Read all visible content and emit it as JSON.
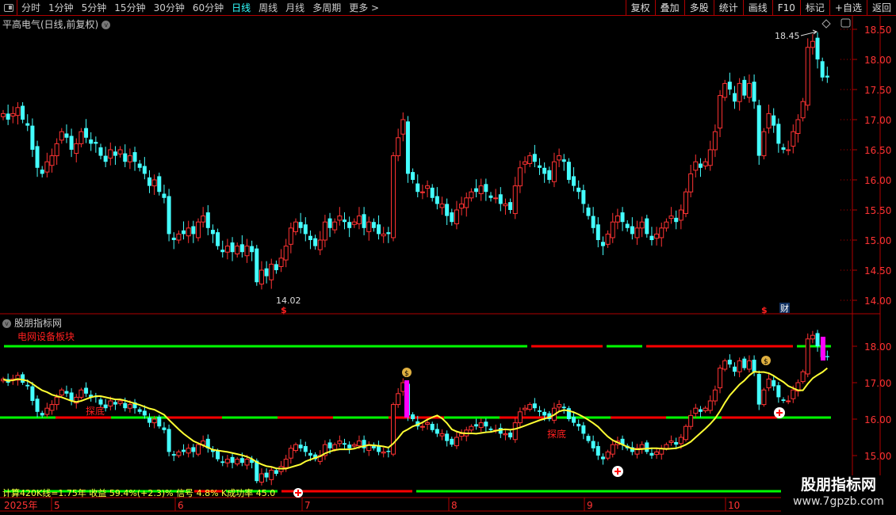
{
  "toolbar": {
    "periods": [
      "分时",
      "1分钟",
      "5分钟",
      "15分钟",
      "30分钟",
      "60分钟",
      "日线",
      "周线",
      "月线",
      "多周期",
      "更多 >"
    ],
    "active": "日线",
    "buttons": [
      "复权",
      "叠加",
      "多股",
      "统计",
      "画线",
      "F10",
      "标记",
      "+自选",
      "返回"
    ]
  },
  "stock": {
    "title": "平高电气(日线,前复权)"
  },
  "price_axis": [
    "18.50",
    "18.00",
    "17.50",
    "17.00",
    "16.50",
    "16.00",
    "15.50",
    "15.00",
    "14.50",
    "14.00"
  ],
  "indicator_axis": [
    "18.00",
    "17.00",
    "16.00",
    "15.00"
  ],
  "annotations": {
    "high": "18.45",
    "low": "14.02",
    "dollar": "$",
    "cai": "财",
    "tandi": "探底"
  },
  "indicator": {
    "title": "股朋指标网",
    "sector": "电网设备板块",
    "stats": "计算420K线=1.75年 收益 59.4%(+2.3)% 信号 4.8% K成功率 45.0"
  },
  "date_axis": [
    {
      "label": "2025年"
    },
    {
      "label": "5"
    },
    {
      "label": "6"
    },
    {
      "label": "7"
    },
    {
      "label": "8"
    },
    {
      "label": "9"
    },
    {
      "label": "10"
    }
  ],
  "watermark": {
    "name": "股朋指标网",
    "url": "www.7gpzb.com"
  },
  "colors": {
    "up": "#ff3333",
    "down": "#44ffff",
    "ma": "#ffff33",
    "green": "#00ff00",
    "red": "#ff0000",
    "axis": "#b00000"
  },
  "closes": [
    17.1,
    17.0,
    17.1,
    17.2,
    17.0,
    16.9,
    16.5,
    16.2,
    16.1,
    16.3,
    16.4,
    16.6,
    16.8,
    16.7,
    16.5,
    16.6,
    16.8,
    16.7,
    16.6,
    16.6,
    16.4,
    16.3,
    16.5,
    16.4,
    16.5,
    16.3,
    16.4,
    16.3,
    16.2,
    16.1,
    15.9,
    16.0,
    15.8,
    15.7,
    15.1,
    15.0,
    15.1,
    15.1,
    15.2,
    15.1,
    15.3,
    15.4,
    15.2,
    15.1,
    14.9,
    14.8,
    14.9,
    14.8,
    14.9,
    14.8,
    14.9,
    14.8,
    14.3,
    14.5,
    14.4,
    14.6,
    14.5,
    14.7,
    14.9,
    15.2,
    15.3,
    15.2,
    15.1,
    15.0,
    14.9,
    15.0,
    15.3,
    15.2,
    15.3,
    15.4,
    15.3,
    15.2,
    15.3,
    15.4,
    15.2,
    15.3,
    15.2,
    15.1,
    15.1,
    15.1,
    16.4,
    16.7,
    17.0,
    16.1,
    16.0,
    15.8,
    15.8,
    15.9,
    15.7,
    15.6,
    15.6,
    15.4,
    15.3,
    15.5,
    15.6,
    15.7,
    15.8,
    15.8,
    15.9,
    15.8,
    15.7,
    15.7,
    15.6,
    15.6,
    15.5,
    15.9,
    16.2,
    16.3,
    16.4,
    16.3,
    16.2,
    16.1,
    16.0,
    16.3,
    16.4,
    16.3,
    16.0,
    15.9,
    15.8,
    15.6,
    15.4,
    15.2,
    15.0,
    14.9,
    15.1,
    15.3,
    15.4,
    15.3,
    15.2,
    15.1,
    15.2,
    15.3,
    15.1,
    15.0,
    15.1,
    15.2,
    15.3,
    15.4,
    15.3,
    15.5,
    15.8,
    16.1,
    16.3,
    16.2,
    16.3,
    16.5,
    16.8,
    17.4,
    17.6,
    17.5,
    17.3,
    17.6,
    17.4,
    17.6,
    17.3,
    16.4,
    16.8,
    17.1,
    16.9,
    16.6,
    16.5,
    16.5,
    16.8,
    17.0,
    17.3,
    18.2,
    18.3,
    18.0,
    17.7,
    17.7
  ]
}
